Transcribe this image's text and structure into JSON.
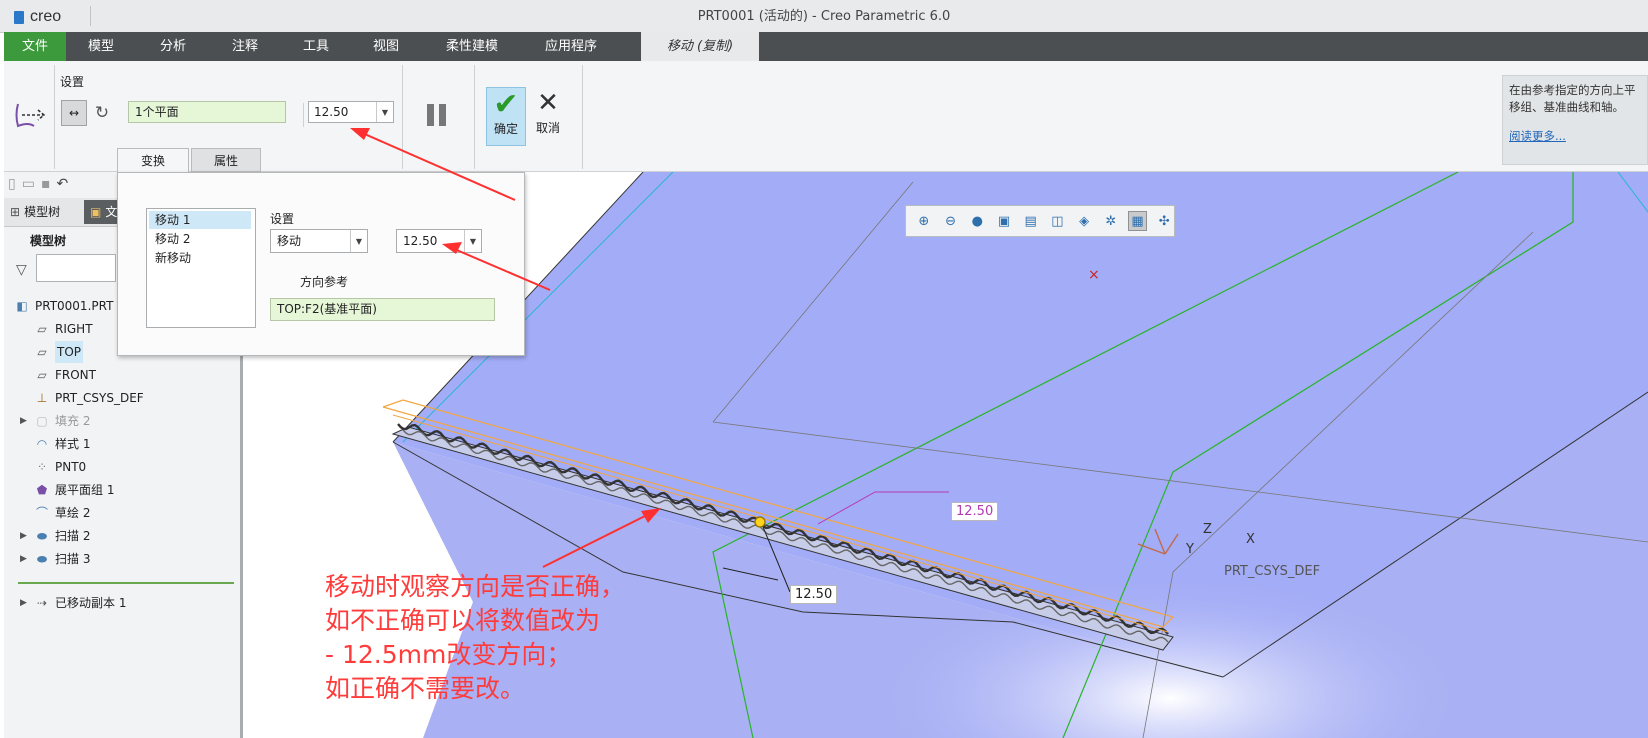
{
  "app": {
    "logo": "creo",
    "window_title": "PRT0001 (活动的) - Creo Parametric 6.0"
  },
  "menu": {
    "items": [
      "文件",
      "模型",
      "分析",
      "注释",
      "工具",
      "视图",
      "柔性建模",
      "应用程序"
    ],
    "active_tab": "移动 (复制)"
  },
  "ribbon": {
    "settings_label": "设置",
    "planes_value": "1个平面",
    "distance_value": "12.50",
    "ok_label": "确定",
    "cancel_label": "取消",
    "help_text": "在由参考指定的方向上平移组、基准曲线和轴。",
    "help_more": "阅读更多..."
  },
  "panel_tabs": {
    "transform": "变换",
    "properties": "属性"
  },
  "dialog": {
    "moves": [
      "移动 1",
      "移动 2",
      "新移动"
    ],
    "settings_label": "设置",
    "type_value": "移动",
    "distance_value": "12.50",
    "direction_ref_label": "方向参考",
    "direction_ref_value": "TOP:F2(基准平面)"
  },
  "model_tree": {
    "tab_label": "模型树",
    "tab2_label": "文",
    "heading": "模型树",
    "items": [
      {
        "label": "PRT0001.PRT",
        "icon": "part-icon"
      },
      {
        "label": "RIGHT",
        "icon": "datum-plane-icon"
      },
      {
        "label": "TOP",
        "icon": "datum-plane-icon"
      },
      {
        "label": "FRONT",
        "icon": "datum-plane-icon"
      },
      {
        "label": "PRT_CSYS_DEF",
        "icon": "csys-icon"
      },
      {
        "label": "填充 2",
        "icon": "fill-icon"
      },
      {
        "label": "样式 1",
        "icon": "style-icon"
      },
      {
        "label": "PNT0",
        "icon": "point-icon"
      },
      {
        "label": "展平面组 1",
        "icon": "flatten-quilt-icon"
      },
      {
        "label": "草绘 2",
        "icon": "sketch-icon"
      },
      {
        "label": "扫描 2",
        "icon": "sweep-icon"
      },
      {
        "label": "扫描 3",
        "icon": "sweep-icon"
      },
      {
        "label": "已移动副本 1",
        "icon": "moved-copy-icon"
      }
    ]
  },
  "viewport": {
    "dim_labels": [
      "12.50",
      "12.50"
    ],
    "csys_label": "PRT_CSYS_DEF",
    "axes": {
      "x": "X",
      "y": "Y",
      "z": "Z"
    },
    "note_lines": [
      "移动时观察方向是否正确，",
      "如不正确可以将数值改为",
      " - 12.5mm改变方向；",
      "如正确不需要改。"
    ]
  },
  "colors": {
    "accent_green": "#3c9a3c",
    "surface_blue": "#a3acf6",
    "annotation_red": "#ff3b3b",
    "datum_green": "#28b428",
    "datum_cyan": "#2ab4d8"
  }
}
